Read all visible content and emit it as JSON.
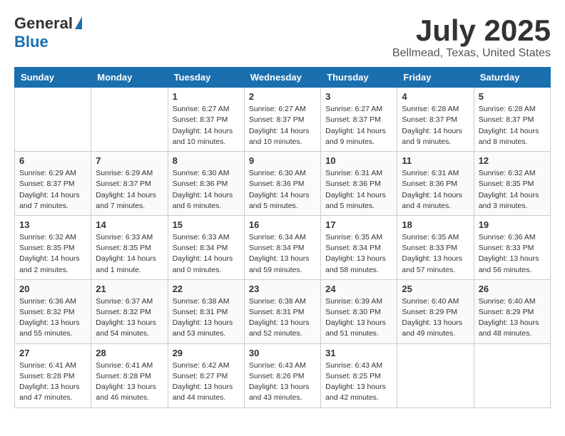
{
  "header": {
    "logo_general": "General",
    "logo_blue": "Blue",
    "month_title": "July 2025",
    "location": "Bellmead, Texas, United States"
  },
  "days_of_week": [
    "Sunday",
    "Monday",
    "Tuesday",
    "Wednesday",
    "Thursday",
    "Friday",
    "Saturday"
  ],
  "weeks": [
    [
      {
        "day": "",
        "info": ""
      },
      {
        "day": "",
        "info": ""
      },
      {
        "day": "1",
        "info": "Sunrise: 6:27 AM\nSunset: 8:37 PM\nDaylight: 14 hours and 10 minutes."
      },
      {
        "day": "2",
        "info": "Sunrise: 6:27 AM\nSunset: 8:37 PM\nDaylight: 14 hours and 10 minutes."
      },
      {
        "day": "3",
        "info": "Sunrise: 6:27 AM\nSunset: 8:37 PM\nDaylight: 14 hours and 9 minutes."
      },
      {
        "day": "4",
        "info": "Sunrise: 6:28 AM\nSunset: 8:37 PM\nDaylight: 14 hours and 9 minutes."
      },
      {
        "day": "5",
        "info": "Sunrise: 6:28 AM\nSunset: 8:37 PM\nDaylight: 14 hours and 8 minutes."
      }
    ],
    [
      {
        "day": "6",
        "info": "Sunrise: 6:29 AM\nSunset: 8:37 PM\nDaylight: 14 hours and 7 minutes."
      },
      {
        "day": "7",
        "info": "Sunrise: 6:29 AM\nSunset: 8:37 PM\nDaylight: 14 hours and 7 minutes."
      },
      {
        "day": "8",
        "info": "Sunrise: 6:30 AM\nSunset: 8:36 PM\nDaylight: 14 hours and 6 minutes."
      },
      {
        "day": "9",
        "info": "Sunrise: 6:30 AM\nSunset: 8:36 PM\nDaylight: 14 hours and 5 minutes."
      },
      {
        "day": "10",
        "info": "Sunrise: 6:31 AM\nSunset: 8:36 PM\nDaylight: 14 hours and 5 minutes."
      },
      {
        "day": "11",
        "info": "Sunrise: 6:31 AM\nSunset: 8:36 PM\nDaylight: 14 hours and 4 minutes."
      },
      {
        "day": "12",
        "info": "Sunrise: 6:32 AM\nSunset: 8:35 PM\nDaylight: 14 hours and 3 minutes."
      }
    ],
    [
      {
        "day": "13",
        "info": "Sunrise: 6:32 AM\nSunset: 8:35 PM\nDaylight: 14 hours and 2 minutes."
      },
      {
        "day": "14",
        "info": "Sunrise: 6:33 AM\nSunset: 8:35 PM\nDaylight: 14 hours and 1 minute."
      },
      {
        "day": "15",
        "info": "Sunrise: 6:33 AM\nSunset: 8:34 PM\nDaylight: 14 hours and 0 minutes."
      },
      {
        "day": "16",
        "info": "Sunrise: 6:34 AM\nSunset: 8:34 PM\nDaylight: 13 hours and 59 minutes."
      },
      {
        "day": "17",
        "info": "Sunrise: 6:35 AM\nSunset: 8:34 PM\nDaylight: 13 hours and 58 minutes."
      },
      {
        "day": "18",
        "info": "Sunrise: 6:35 AM\nSunset: 8:33 PM\nDaylight: 13 hours and 57 minutes."
      },
      {
        "day": "19",
        "info": "Sunrise: 6:36 AM\nSunset: 8:33 PM\nDaylight: 13 hours and 56 minutes."
      }
    ],
    [
      {
        "day": "20",
        "info": "Sunrise: 6:36 AM\nSunset: 8:32 PM\nDaylight: 13 hours and 55 minutes."
      },
      {
        "day": "21",
        "info": "Sunrise: 6:37 AM\nSunset: 8:32 PM\nDaylight: 13 hours and 54 minutes."
      },
      {
        "day": "22",
        "info": "Sunrise: 6:38 AM\nSunset: 8:31 PM\nDaylight: 13 hours and 53 minutes."
      },
      {
        "day": "23",
        "info": "Sunrise: 6:38 AM\nSunset: 8:31 PM\nDaylight: 13 hours and 52 minutes."
      },
      {
        "day": "24",
        "info": "Sunrise: 6:39 AM\nSunset: 8:30 PM\nDaylight: 13 hours and 51 minutes."
      },
      {
        "day": "25",
        "info": "Sunrise: 6:40 AM\nSunset: 8:29 PM\nDaylight: 13 hours and 49 minutes."
      },
      {
        "day": "26",
        "info": "Sunrise: 6:40 AM\nSunset: 8:29 PM\nDaylight: 13 hours and 48 minutes."
      }
    ],
    [
      {
        "day": "27",
        "info": "Sunrise: 6:41 AM\nSunset: 8:28 PM\nDaylight: 13 hours and 47 minutes."
      },
      {
        "day": "28",
        "info": "Sunrise: 6:41 AM\nSunset: 8:28 PM\nDaylight: 13 hours and 46 minutes."
      },
      {
        "day": "29",
        "info": "Sunrise: 6:42 AM\nSunset: 8:27 PM\nDaylight: 13 hours and 44 minutes."
      },
      {
        "day": "30",
        "info": "Sunrise: 6:43 AM\nSunset: 8:26 PM\nDaylight: 13 hours and 43 minutes."
      },
      {
        "day": "31",
        "info": "Sunrise: 6:43 AM\nSunset: 8:25 PM\nDaylight: 13 hours and 42 minutes."
      },
      {
        "day": "",
        "info": ""
      },
      {
        "day": "",
        "info": ""
      }
    ]
  ]
}
